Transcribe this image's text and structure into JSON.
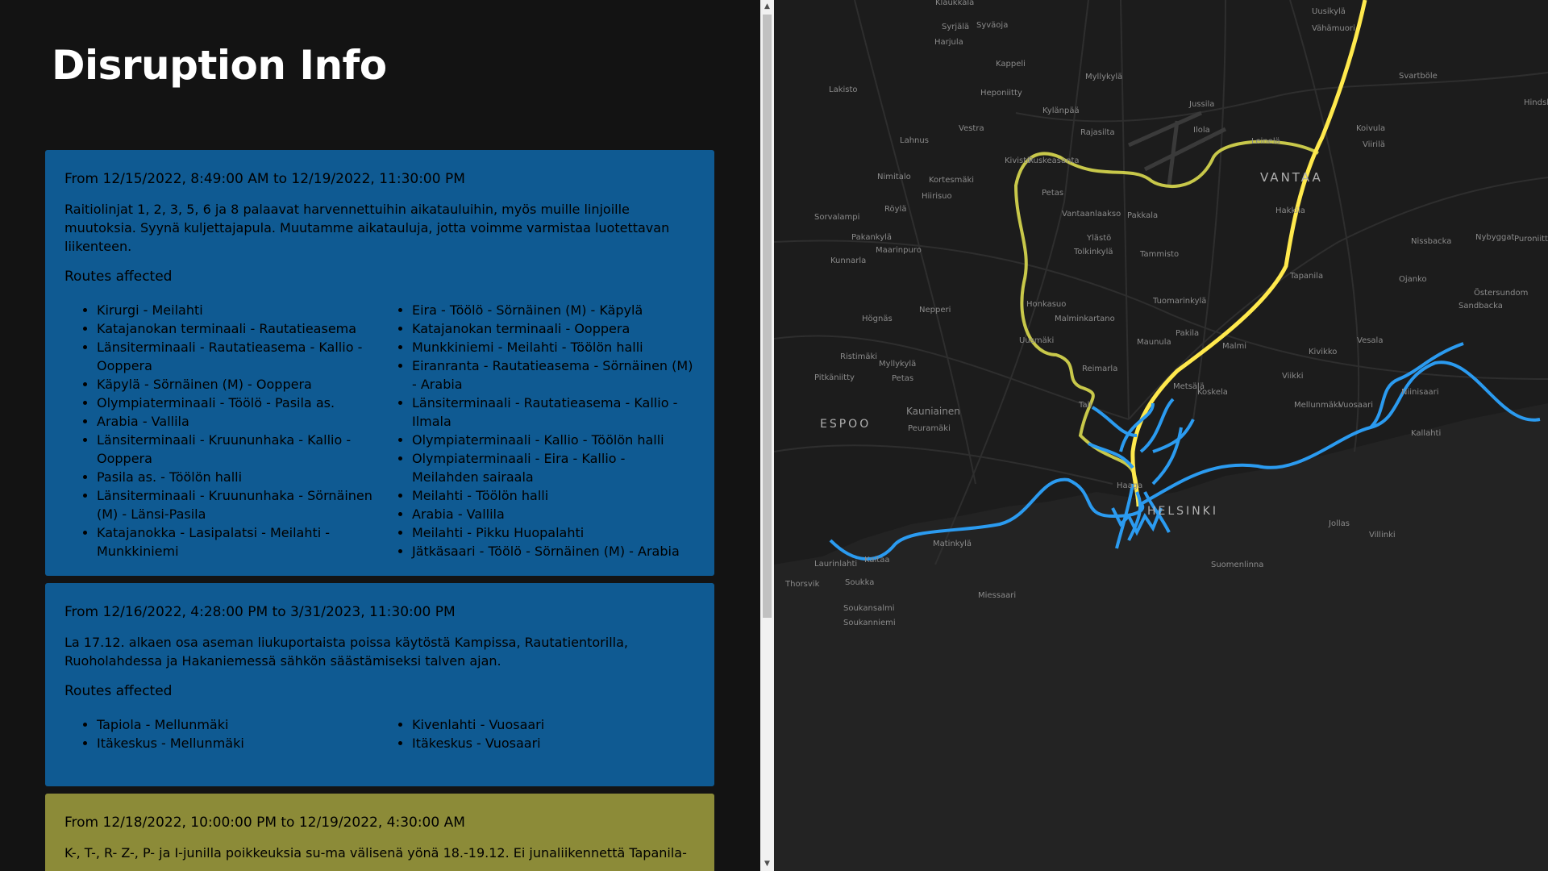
{
  "page": {
    "title": "Disruption Info"
  },
  "disruptions": [
    {
      "period": "From 12/15/2022, 8:49:00 AM to 12/19/2022, 11:30:00 PM",
      "description": "Raitiolinjat 1, 2, 3, 5, 6 ja 8 palaavat harvennettuihin aikatauluihin, myös muille linjoille muutoksia. Syynä kuljettajapula. Muutamme aikatauluja, jotta voimme varmistaa luotettavan liikenteen.",
      "routes_heading": "Routes affected",
      "routes": [
        "Kirurgi - Meilahti",
        "Katajanokan terminaali - Rautatieasema",
        "Länsiterminaali - Rautatieasema - Kallio - Ooppera",
        "Käpylä - Sörnäinen (M) - Ooppera",
        "Olympiaterminaali - Töölö - Pasila as.",
        "Arabia - Vallila",
        "Länsiterminaali - Kruununhaka - Kallio - Ooppera",
        "Pasila as. - Töölön halli",
        "Länsiterminaali - Kruununhaka - Sörnäinen (M) - Länsi-Pasila",
        "Katajanokka - Lasipalatsi - Meilahti - Munkkiniemi",
        "Eira - Töölö - Sörnäinen (M) - Käpylä",
        "Katajanokan terminaali - Ooppera",
        "Munkkiniemi - Meilahti - Töölön halli",
        "Eiranranta - Rautatieasema - Sörnäinen (M) - Arabia",
        "Länsiterminaali - Rautatieasema - Kallio - Ilmala",
        "Olympiaterminaali - Kallio - Töölön halli",
        "Olympiaterminaali - Eira - Kallio - Meilahden sairaala",
        "Meilahti - Töölön halli",
        "Arabia - Vallila",
        "Meilahti - Pikku Huopalahti",
        "Jätkäsaari - Töölö - Sörnäinen (M) - Arabia"
      ],
      "color": "#0f5a92"
    },
    {
      "period": "From 12/16/2022, 4:28:00 PM to 3/31/2023, 11:30:00 PM",
      "description": "La 17.12. alkaen osa aseman liukuportaista poissa käytöstä Kampissa, Rautatientorilla, Ruoholahdessa ja Hakaniemessä sähkön säästämiseksi talven ajan.",
      "routes_heading": "Routes affected",
      "routes": [
        "Tapiola - Mellunmäki",
        "Itäkeskus - Mellunmäki",
        "Kivenlahti - Vuosaari",
        "Itäkeskus - Vuosaari"
      ],
      "color": "#0f5a92"
    },
    {
      "period": "From 12/18/2022, 10:00:00 PM to 12/19/2022, 4:30:00 AM",
      "description": "K-, T-, R- Z-, P- ja I-junilla poikkeuksia su-ma välisenä yönä 18.-19.12. Ei junaliikennettä Tapanila-",
      "color": "#8c8b38"
    }
  ],
  "map": {
    "places": [
      "Klaukkala",
      "Syrjälä",
      "Syväoja",
      "Harjula",
      "Kappeli",
      "Heponiitty",
      "Myllykylä",
      "Kylänpää",
      "Uusikylä",
      "Vähämuori",
      "Lakisto",
      "Vestra",
      "Jussila",
      "Svartböle",
      "Hindsby",
      "Lahnus",
      "Rajasilta",
      "Ilola",
      "Leinelä",
      "Koivula",
      "Viirilä",
      "Kivistö",
      "Ruskeasanta",
      "Nimitalo",
      "Kortesmäki",
      "Hiirisuo",
      "VANTAA",
      "Petas",
      "Röylä",
      "Vantaanlaakso",
      "Pakkala",
      "Hakkila",
      "Sorvalampi",
      "Pakankylä",
      "Ylästö",
      "Tolkinkylä",
      "Tammisto",
      "Nissbacka",
      "Nybyggat",
      "Puroniitty",
      "Maarinpuro",
      "Kunnarla",
      "Tapanila",
      "Ojanko",
      "Östersundom",
      "Sandbacka",
      "Honkasuo",
      "Nepperi",
      "Tuomarinkylä",
      "Högnäs",
      "Malminkartano",
      "Pakila",
      "Uusmäki",
      "Maunula",
      "Malmi",
      "Vesala",
      "Kivikko",
      "Ristimäki",
      "Myllykylä",
      "Reimarla",
      "Pitkäniitty",
      "Petas",
      "Viikki",
      "Metsälä",
      "Koskela",
      "Niinisaari",
      "Kauniainen",
      "Tali",
      "ESPOO",
      "Peuramäki",
      "Mellunmäki",
      "Vuosaari",
      "Kallahti",
      "Haaga",
      "HELSINKI",
      "Matinkylä",
      "Laurinlahti",
      "Kaitaa",
      "Soukka",
      "Thorsvik",
      "Jollas",
      "Villinki",
      "Suomenlinna",
      "Miessaari",
      "Soukansalmi",
      "Soukanniemi"
    ],
    "line_colors": {
      "yellow": "#ffe94d",
      "olive_yellow": "#c8c84a",
      "blue": "#2b9bf0"
    }
  }
}
